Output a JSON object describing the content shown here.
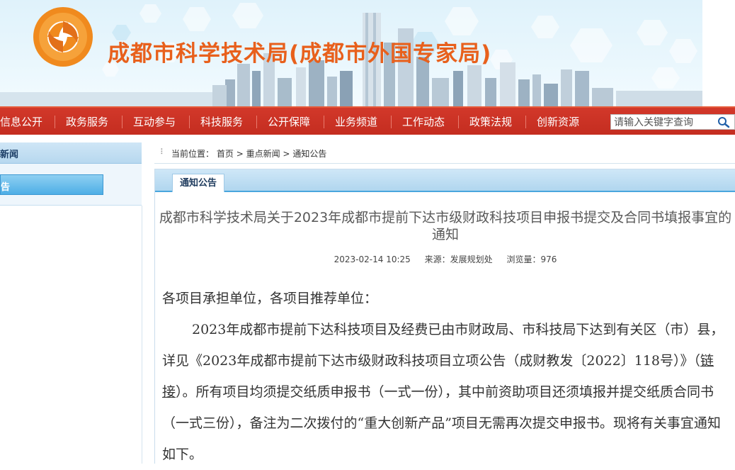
{
  "header": {
    "site_title": "成都市科学技术局(成都市外国专家局)"
  },
  "nav": {
    "items": [
      "信息公开",
      "政务服务",
      "互动参与",
      "科技服务",
      "公开保障",
      "业务频道",
      "工作动态",
      "政策法规",
      "创新资源"
    ],
    "search_placeholder": "请输入关键字查询"
  },
  "sidebar": {
    "section_title": "新闻",
    "active_item": "告"
  },
  "breadcrumb": {
    "prefix": "当前位置：",
    "home": "首页",
    "sep": ">",
    "level1": "重点新闻",
    "level2": "通知公告"
  },
  "tab": {
    "label": "通知公告"
  },
  "article": {
    "title": "成都市科学技术局关于2023年成都市提前下达市级财政科技项目申报书提交及合同书填报事宜的通知",
    "date": "2023-02-14 10:25",
    "source": "来源：发展规划处",
    "views": "浏览量：976",
    "greeting": "各项目承担单位，各项目推荐单位：",
    "para_before_link": "2023年成都市提前下达科技项目及经费已由市财政局、市科技局下达到有关区（市）县，详见《2023年成都市提前下达市级财政科技项目立项公告（成财教发〔2022〕118号）》（",
    "link_text": "链接",
    "para_after_link": "）。所有项目均须提交纸质申报书（一式一份），其中前资助项目还须填报并提交纸质合同书（一式三份），备注为二次拨付的“重大创新产品”项目无需再次提交申报书。现将有关事宜通知如下。"
  },
  "colors": {
    "nav_red": "#c42d20",
    "title_orange": "#e8601c",
    "tab_blue": "#4aa6dd"
  }
}
